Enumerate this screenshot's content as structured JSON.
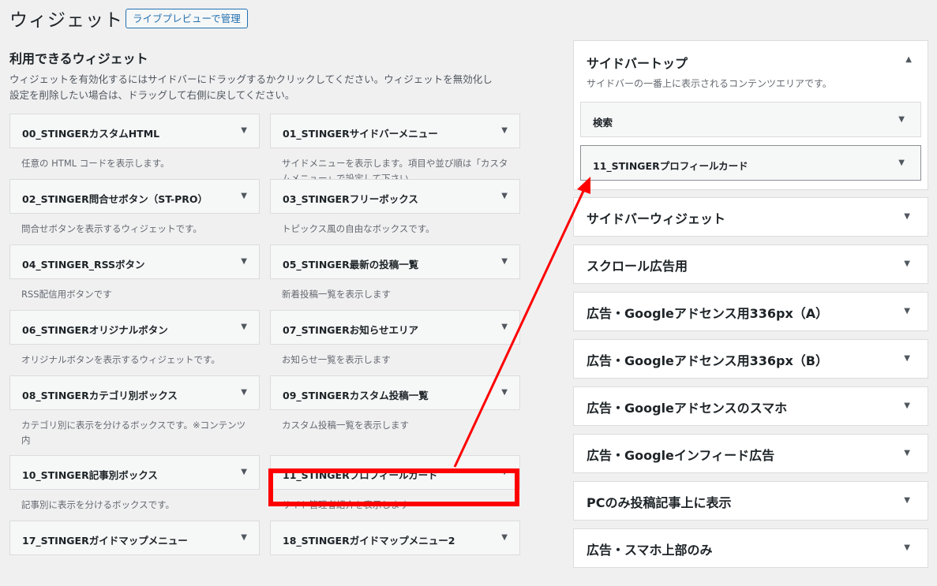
{
  "page_title": "ウィジェット",
  "preview_button": "ライブプレビューで管理",
  "available": {
    "title": "利用できるウィジェット",
    "desc_line1": "ウィジェットを有効化するにはサイドバーにドラッグするかクリックしてください。ウィジェットを無効化し",
    "desc_line2": "設定を削除したい場合は、ドラッグして右側に戻してください。"
  },
  "widgets": [
    {
      "name": "00_STINGERカスタムHTML",
      "desc": "任意の HTML コードを表示します。"
    },
    {
      "name": "01_STINGERサイドバーメニュー",
      "desc": "サイドメニューを表示します。項目や並び順は「カスタムメニュー」で設定して下さい"
    },
    {
      "name": "02_STINGER問合せボタン（ST-PRO）",
      "desc": "問合せボタンを表示するウィジェットです。"
    },
    {
      "name": "03_STINGERフリーボックス",
      "desc": "トピックス風の自由なボックスです。"
    },
    {
      "name": "04_STINGER_RSSボタン",
      "desc": "RSS配信用ボタンです"
    },
    {
      "name": "05_STINGER最新の投稿一覧",
      "desc": "新着投稿一覧を表示します"
    },
    {
      "name": "06_STINGERオリジナルボタン",
      "desc": "オリジナルボタンを表示するウィジェットです。"
    },
    {
      "name": "07_STINGERお知らせエリア",
      "desc": "お知らせ一覧を表示します"
    },
    {
      "name": "08_STINGERカテゴリ別ボックス",
      "desc": "カテゴリ別に表示を分けるボックスです。※コンテンツ内"
    },
    {
      "name": "09_STINGERカスタム投稿一覧",
      "desc": "カスタム投稿一覧を表示します"
    },
    {
      "name": "10_STINGER記事別ボックス",
      "desc": "記事別に表示を分けるボックスです。"
    },
    {
      "name": "11_STINGERプロフィールカード",
      "desc": "サイト管理者紹介を表示します"
    },
    {
      "name": "17_STINGERガイドマップメニュー",
      "desc": ""
    },
    {
      "name": "18_STINGERガイドマップメニュー2",
      "desc": ""
    }
  ],
  "sidebar_top": {
    "title": "サイドバートップ",
    "desc": "サイドバーの一番上に表示されるコンテンツエリアです。",
    "items": [
      "検索",
      "11_STINGERプロフィールカード"
    ]
  },
  "sidebars": [
    "サイドバーウィジェット",
    "スクロール広告用",
    "広告・Googleアドセンス用336px（A）",
    "広告・Googleアドセンス用336px（B）",
    "広告・Googleアドセンスのスマホ",
    "広告・Googleインフィード広告",
    "PCのみ投稿記事上に表示",
    "広告・スマホ上部のみ"
  ],
  "icons": {
    "collapse": "triangle-down",
    "expand": "triangle-up"
  },
  "colors": {
    "accent": "#2271b1",
    "highlight": "#ff0000"
  }
}
